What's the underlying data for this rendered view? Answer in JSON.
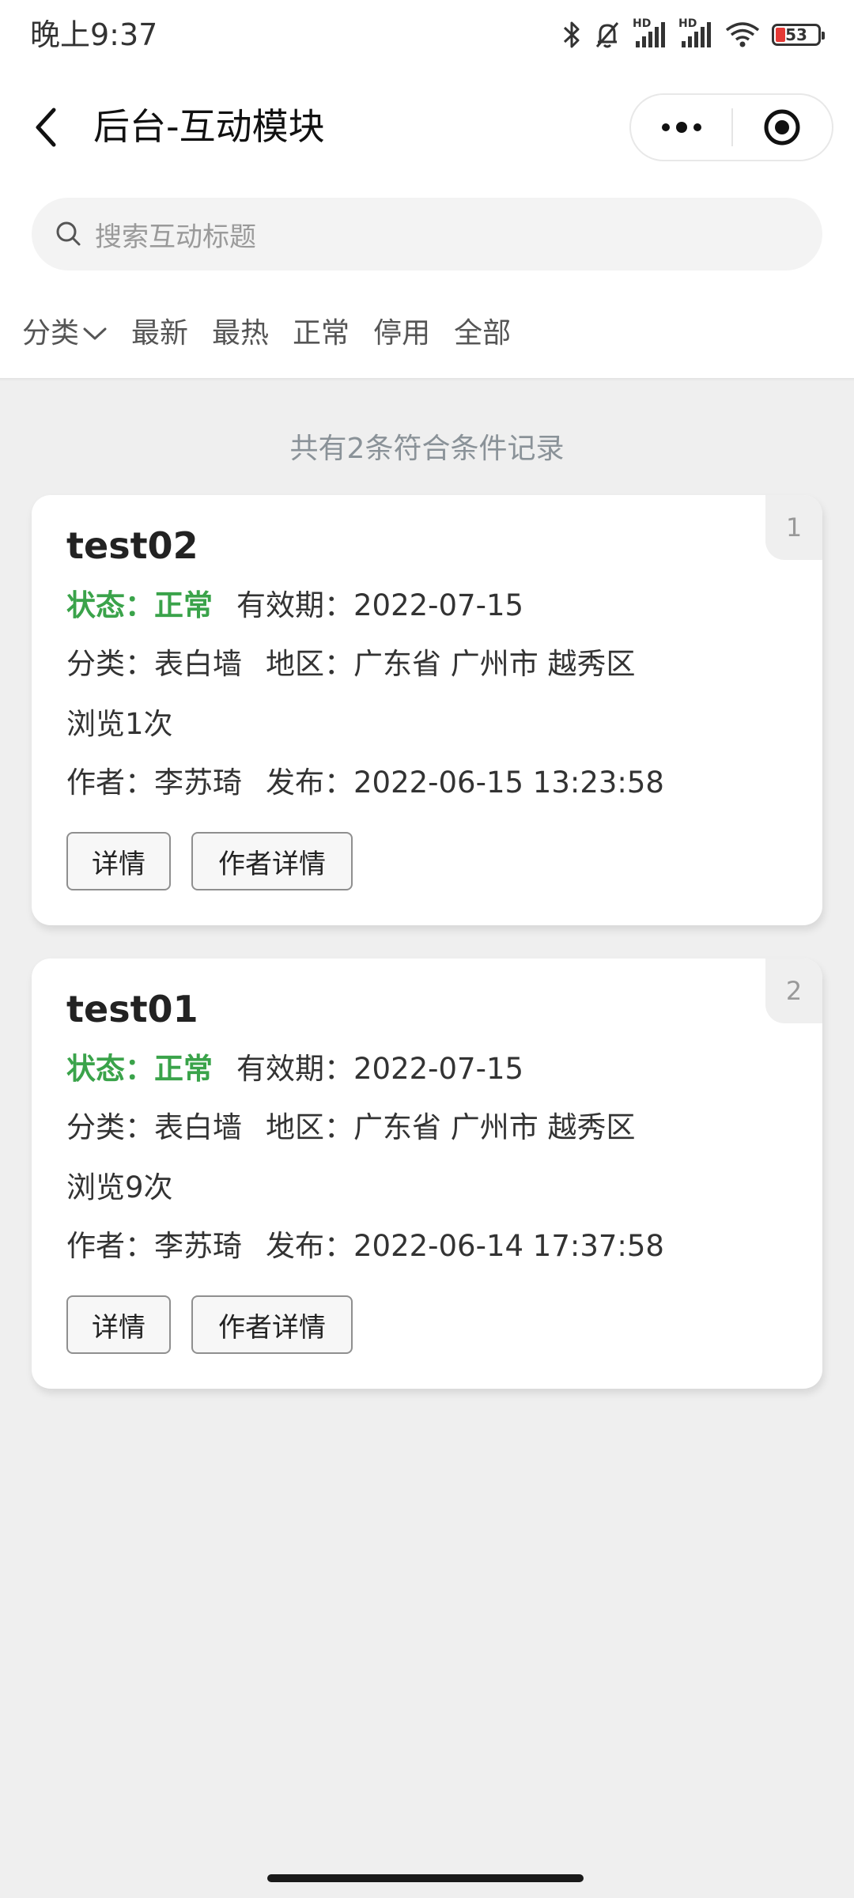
{
  "status_bar": {
    "time": "晚上9:37",
    "battery": "53",
    "icons": [
      "bluetooth-icon",
      "mute-bell-icon",
      "hd-signal-icon",
      "hd-signal-icon",
      "wifi-icon",
      "battery-icon"
    ],
    "hd_label": "HD"
  },
  "nav": {
    "title": "后台-互动模块",
    "back_icon": "chevron-left-icon",
    "more_icon": "more-dots-icon",
    "close_icon": "target-circle-icon"
  },
  "search": {
    "placeholder": "搜索互动标题"
  },
  "filters": [
    "分类",
    "最新",
    "最热",
    "正常",
    "停用",
    "全部"
  ],
  "result_count": "共有2条符合条件记录",
  "labels": {
    "status": "状态：",
    "valid": "有效期：",
    "category": "分类：",
    "region": "地区：",
    "author": "作者：",
    "publish": "发布：",
    "detail_btn": "详情",
    "author_detail_btn": "作者详情"
  },
  "items": [
    {
      "index": "1",
      "title": "test02",
      "status": "正常",
      "valid_until": "2022-07-15",
      "category": "表白墙",
      "region": "广东省 广州市 越秀区",
      "views": "浏览1次",
      "author": "李苏琦",
      "published": "2022-06-15 13:23:58"
    },
    {
      "index": "2",
      "title": "test01",
      "status": "正常",
      "valid_until": "2022-07-15",
      "category": "表白墙",
      "region": "广东省 广州市 越秀区",
      "views": "浏览9次",
      "author": "李苏琦",
      "published": "2022-06-14 17:37:58"
    }
  ],
  "colors": {
    "status_green": "#3aa34a",
    "page_bg": "#efefef",
    "card_bg": "#ffffff"
  }
}
